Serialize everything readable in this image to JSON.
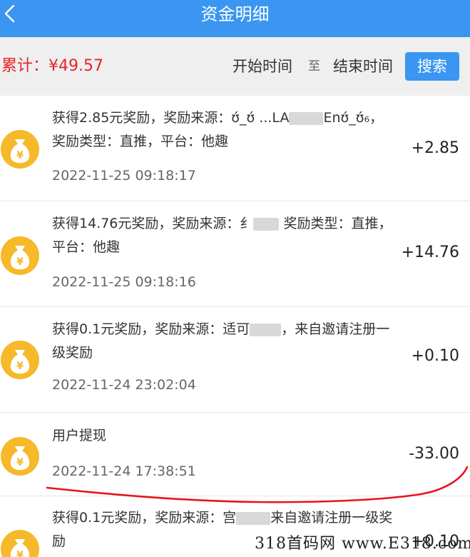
{
  "header": {
    "title": "资金明细",
    "back_icon": "chevron-left-icon"
  },
  "filter": {
    "total_label": "累计：",
    "total_value": "¥49.57",
    "start_time": "开始时间",
    "to": "至",
    "end_time": "结束时间",
    "search": "搜索"
  },
  "records": [
    {
      "desc_a": "获得2.85元奖励，奖励来源：ʊ́_ʊ́ ...LA",
      "desc_b": "Enʊ́_ʊ́₆，",
      "desc_c": "奖励类型：直推，平台：他趣",
      "time": "2022-11-25 09:18:17",
      "amount": "+2.85"
    },
    {
      "desc_a": "获得14.76元奖励，奖励来源：纟",
      "desc_b": " 奖励类型：直推，平台：他趣",
      "time": "2022-11-25 09:18:16",
      "amount": "+14.76"
    },
    {
      "desc_a": "获得0.1元奖励，奖励来源：适可",
      "desc_b": "，来自邀请注册一级奖励",
      "time": "2022-11-24 23:02:04",
      "amount": "+0.10"
    },
    {
      "desc_a": "用户提现",
      "time": "2022-11-24 17:38:51",
      "amount": "-33.00"
    },
    {
      "desc_a": "获得0.1元奖励，奖励来源：宫",
      "desc_b": "来自邀请注册一级奖励",
      "amount": "+0.10"
    }
  ],
  "watermark": "318首码网 www.E318.com",
  "colors": {
    "accent": "#3a96f0",
    "total": "#e6262b",
    "annotation": "#e8141b",
    "coin": "#f5b92a"
  }
}
